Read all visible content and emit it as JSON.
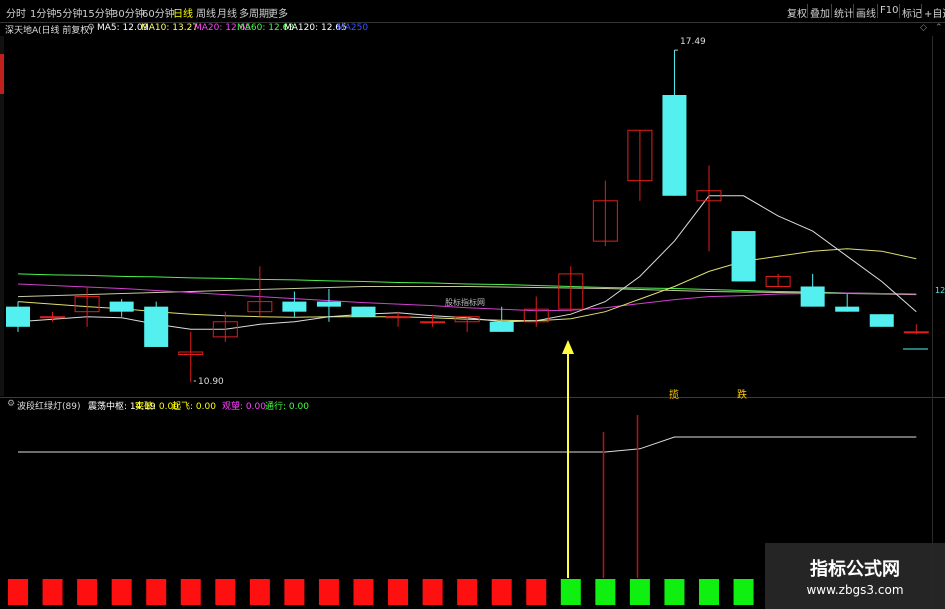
{
  "toolbar": {
    "timeframes": [
      "分时",
      "1分钟",
      "5分钟",
      "15分钟",
      "30分钟",
      "60分钟",
      "日线",
      "周线",
      "月线",
      "多周期",
      "更多"
    ],
    "active": "日线",
    "right_buttons": [
      "复权",
      "叠加",
      "统计",
      "画线",
      "F10",
      "标记",
      "+自选"
    ]
  },
  "main": {
    "stock_name": "深天地A",
    "period_label": "(日线 前复权)",
    "ma": [
      {
        "label": "MA5: 12.09",
        "color": "#ffffff"
      },
      {
        "label": "MA10: 13.27",
        "color": "#ffff66"
      },
      {
        "label": "MA20: 12.65",
        "color": "#ff44ff"
      },
      {
        "label": "MA60: 12.63",
        "color": "#44ff44"
      },
      {
        "label": "MA120: 12.65",
        "color": "#ffffff"
      },
      {
        "label": "MA250",
        "color": "#3355ff"
      }
    ],
    "high_label": "17.49",
    "low_label": "10.90",
    "center_watermark": "股标指标网",
    "right_edge_label": "12",
    "marker_zhang": "揽",
    "marker_die": "跌"
  },
  "indicator": {
    "title": "波段红绿灯(89)",
    "fields": [
      {
        "label": "震荡中枢: 14.19",
        "color": "#ffffff"
      },
      {
        "label": "突破: 0.00",
        "color": "#ffff00"
      },
      {
        "label": "起飞: 0.00",
        "color": "#ffff00"
      },
      {
        "label": "观望: 0.00",
        "color": "#ff44ff"
      },
      {
        "label": "通行: 0.00",
        "color": "#44ff44"
      }
    ],
    "lights": [
      "red",
      "red",
      "red",
      "red",
      "red",
      "red",
      "red",
      "red",
      "red",
      "red",
      "red",
      "red",
      "red",
      "red",
      "red",
      "red",
      "green",
      "green",
      "green",
      "green",
      "green",
      "green"
    ]
  },
  "watermark": {
    "title": "指标公式网",
    "url": "www.zbgs3.com"
  },
  "colors": {
    "up": "#e0201c",
    "down": "#54f0f0",
    "bg": "#000000",
    "light_red": "#ff1010",
    "light_green": "#10f010"
  },
  "chart_data": {
    "type": "candlestick",
    "candles": [
      {
        "o": 12.4,
        "h": 12.5,
        "l": 11.9,
        "c": 12.0
      },
      {
        "o": 12.2,
        "h": 12.3,
        "l": 12.1,
        "c": 12.2
      },
      {
        "o": 12.3,
        "h": 12.8,
        "l": 12.0,
        "c": 12.6
      },
      {
        "o": 12.5,
        "h": 12.55,
        "l": 12.2,
        "c": 12.3
      },
      {
        "o": 12.4,
        "h": 12.5,
        "l": 11.6,
        "c": 11.6
      },
      {
        "o": 11.45,
        "h": 11.9,
        "l": 10.9,
        "c": 11.5
      },
      {
        "o": 11.8,
        "h": 12.3,
        "l": 11.7,
        "c": 12.1
      },
      {
        "o": 12.3,
        "h": 13.2,
        "l": 12.2,
        "c": 12.5
      },
      {
        "o": 12.5,
        "h": 12.7,
        "l": 12.2,
        "c": 12.3
      },
      {
        "o": 12.5,
        "h": 12.75,
        "l": 12.1,
        "c": 12.4
      },
      {
        "o": 12.4,
        "h": 12.4,
        "l": 12.2,
        "c": 12.2
      },
      {
        "o": 12.2,
        "h": 12.3,
        "l": 12.0,
        "c": 12.2
      },
      {
        "o": 12.1,
        "h": 12.25,
        "l": 12.0,
        "c": 12.1
      },
      {
        "o": 12.1,
        "h": 12.2,
        "l": 11.9,
        "c": 12.2
      },
      {
        "o": 12.1,
        "h": 12.4,
        "l": 11.9,
        "c": 11.9
      },
      {
        "o": 12.1,
        "h": 12.6,
        "l": 12.0,
        "c": 12.35
      },
      {
        "o": 12.35,
        "h": 13.2,
        "l": 12.3,
        "c": 13.05
      },
      {
        "o": 13.7,
        "h": 14.9,
        "l": 13.6,
        "c": 14.5
      },
      {
        "o": 14.9,
        "h": 15.9,
        "l": 14.5,
        "c": 15.9
      },
      {
        "o": 16.6,
        "h": 17.49,
        "l": 14.6,
        "c": 14.6
      },
      {
        "o": 14.5,
        "h": 15.2,
        "l": 13.5,
        "c": 14.7
      },
      {
        "o": 13.9,
        "h": 13.9,
        "l": 12.9,
        "c": 12.9
      },
      {
        "o": 12.8,
        "h": 13.05,
        "l": 12.8,
        "c": 13.0
      },
      {
        "o": 12.8,
        "h": 13.05,
        "l": 12.4,
        "c": 12.4
      },
      {
        "o": 12.4,
        "h": 12.65,
        "l": 12.3,
        "c": 12.3
      },
      {
        "o": 12.25,
        "h": 12.25,
        "l": 12.0,
        "c": 12.0
      },
      {
        "o": 11.9,
        "h": 12.05,
        "l": 11.85,
        "c": 11.9
      }
    ],
    "ma5": [
      12.1,
      12.15,
      12.2,
      12.18,
      12.05,
      11.95,
      11.95,
      12.05,
      12.1,
      12.2,
      12.25,
      12.28,
      12.22,
      12.18,
      12.1,
      12.12,
      12.25,
      12.5,
      13.0,
      13.7,
      14.6,
      14.6,
      14.2,
      13.9,
      13.4,
      12.9,
      12.3
    ],
    "ma10": [
      12.5,
      12.45,
      12.4,
      12.36,
      12.3,
      12.25,
      12.22,
      12.2,
      12.19,
      12.2,
      12.2,
      12.2,
      12.18,
      12.15,
      12.13,
      12.12,
      12.16,
      12.3,
      12.55,
      12.8,
      13.1,
      13.3,
      13.4,
      13.5,
      13.55,
      13.5,
      13.35
    ],
    "ma20": [
      12.85,
      12.82,
      12.79,
      12.76,
      12.72,
      12.68,
      12.64,
      12.6,
      12.56,
      12.52,
      12.48,
      12.45,
      12.42,
      12.38,
      12.35,
      12.32,
      12.33,
      12.38,
      12.46,
      12.54,
      12.6,
      12.62,
      12.65,
      12.66,
      12.67,
      12.66,
      12.65
    ],
    "ma60": [
      13.05,
      13.03,
      13.02,
      13.0,
      12.99,
      12.97,
      12.96,
      12.94,
      12.93,
      12.91,
      12.9,
      12.88,
      12.87,
      12.85,
      12.84,
      12.82,
      12.8,
      12.78,
      12.77,
      12.76,
      12.74,
      12.72,
      12.7,
      12.69,
      12.67,
      12.66,
      12.65
    ],
    "ma120": [
      12.6,
      12.62,
      12.64,
      12.66,
      12.68,
      12.7,
      12.72,
      12.74,
      12.76,
      12.78,
      12.8,
      12.8,
      12.8,
      12.8,
      12.79,
      12.78,
      12.77,
      12.76,
      12.74,
      12.72,
      12.7,
      12.69,
      12.68,
      12.67,
      12.66,
      12.65,
      12.64
    ],
    "zhongshu": [
      14.19,
      14.19,
      14.19,
      14.19,
      14.19,
      14.19,
      14.19,
      14.19,
      14.19,
      14.19,
      14.19,
      14.19,
      14.19,
      14.19,
      14.19,
      14.19,
      14.19,
      14.19,
      14.3,
      14.7,
      14.7,
      14.7,
      14.7,
      14.7,
      14.7,
      14.7,
      14.7
    ]
  }
}
